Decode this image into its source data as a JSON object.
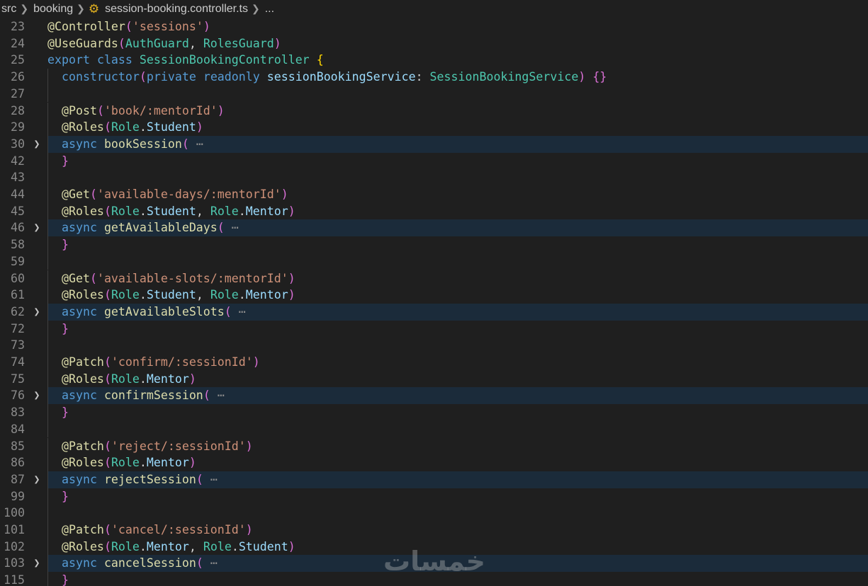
{
  "breadcrumb": {
    "items": [
      "src",
      "booking",
      "session-booking.controller.ts",
      "..."
    ],
    "file_icon": "gear-icon",
    "separator_icon": "chevron-right-icon"
  },
  "colors": {
    "background": "#1f1f1f",
    "highlight": "#1b2b3a",
    "decorator": "#dcdcaa",
    "string": "#ce9178",
    "type": "#4ec9b0",
    "keyword": "#569cd6",
    "variable": "#9cdcfe",
    "paren": "#da70d6",
    "brace": "#ffd700"
  },
  "editor": {
    "lines": [
      {
        "n": "23",
        "tokens": [
          [
            "dec",
            "@Controller"
          ],
          [
            "paren",
            "("
          ],
          [
            "str",
            "'sessions'"
          ],
          [
            "paren",
            ")"
          ]
        ]
      },
      {
        "n": "24",
        "tokens": [
          [
            "dec",
            "@UseGuards"
          ],
          [
            "paren",
            "("
          ],
          [
            "typ",
            "AuthGuard"
          ],
          [
            "pl",
            ", "
          ],
          [
            "typ",
            "RolesGuard"
          ],
          [
            "paren",
            ")"
          ]
        ]
      },
      {
        "n": "25",
        "tokens": [
          [
            "kw",
            "export"
          ],
          [
            "pl",
            " "
          ],
          [
            "kw",
            "class"
          ],
          [
            "pl",
            " "
          ],
          [
            "typ",
            "SessionBookingController"
          ],
          [
            "pl",
            " "
          ],
          [
            "br",
            "{"
          ]
        ]
      },
      {
        "n": "26",
        "tokens": [
          [
            "pl",
            "  "
          ],
          [
            "kw",
            "constructor"
          ],
          [
            "paren",
            "("
          ],
          [
            "kw",
            "private"
          ],
          [
            "pl",
            " "
          ],
          [
            "kw",
            "readonly"
          ],
          [
            "pl",
            " "
          ],
          [
            "vr",
            "sessionBookingService"
          ],
          [
            "pl",
            ": "
          ],
          [
            "typ",
            "SessionBookingService"
          ],
          [
            "paren",
            ")"
          ],
          [
            "pl",
            " "
          ],
          [
            "paren",
            "{}"
          ]
        ]
      },
      {
        "n": "27",
        "tokens": []
      },
      {
        "n": "28",
        "tokens": [
          [
            "pl",
            "  "
          ],
          [
            "dec",
            "@Post"
          ],
          [
            "paren",
            "("
          ],
          [
            "str",
            "'book/:mentorId'"
          ],
          [
            "paren",
            ")"
          ]
        ]
      },
      {
        "n": "29",
        "tokens": [
          [
            "pl",
            "  "
          ],
          [
            "dec",
            "@Roles"
          ],
          [
            "paren",
            "("
          ],
          [
            "typ",
            "Role"
          ],
          [
            "pl",
            "."
          ],
          [
            "vr",
            "Student"
          ],
          [
            "paren",
            ")"
          ]
        ]
      },
      {
        "n": "30",
        "fold": true,
        "tokens": [
          [
            "pl",
            "  "
          ],
          [
            "kw",
            "async"
          ],
          [
            "pl",
            " "
          ],
          [
            "fn",
            "bookSession"
          ],
          [
            "paren",
            "("
          ],
          [
            "pl",
            " "
          ],
          [
            "dots",
            "⋯"
          ]
        ]
      },
      {
        "n": "42",
        "tokens": [
          [
            "pl",
            "  "
          ],
          [
            "paren",
            "}"
          ]
        ]
      },
      {
        "n": "43",
        "tokens": []
      },
      {
        "n": "44",
        "tokens": [
          [
            "pl",
            "  "
          ],
          [
            "dec",
            "@Get"
          ],
          [
            "paren",
            "("
          ],
          [
            "str",
            "'available-days/:mentorId'"
          ],
          [
            "paren",
            ")"
          ]
        ]
      },
      {
        "n": "45",
        "tokens": [
          [
            "pl",
            "  "
          ],
          [
            "dec",
            "@Roles"
          ],
          [
            "paren",
            "("
          ],
          [
            "typ",
            "Role"
          ],
          [
            "pl",
            "."
          ],
          [
            "vr",
            "Student"
          ],
          [
            "pl",
            ", "
          ],
          [
            "typ",
            "Role"
          ],
          [
            "pl",
            "."
          ],
          [
            "vr",
            "Mentor"
          ],
          [
            "paren",
            ")"
          ]
        ]
      },
      {
        "n": "46",
        "fold": true,
        "tokens": [
          [
            "pl",
            "  "
          ],
          [
            "kw",
            "async"
          ],
          [
            "pl",
            " "
          ],
          [
            "fn",
            "getAvailableDays"
          ],
          [
            "paren",
            "("
          ],
          [
            "pl",
            " "
          ],
          [
            "dots",
            "⋯"
          ]
        ]
      },
      {
        "n": "58",
        "tokens": [
          [
            "pl",
            "  "
          ],
          [
            "paren",
            "}"
          ]
        ]
      },
      {
        "n": "59",
        "tokens": []
      },
      {
        "n": "60",
        "tokens": [
          [
            "pl",
            "  "
          ],
          [
            "dec",
            "@Get"
          ],
          [
            "paren",
            "("
          ],
          [
            "str",
            "'available-slots/:mentorId'"
          ],
          [
            "paren",
            ")"
          ]
        ]
      },
      {
        "n": "61",
        "tokens": [
          [
            "pl",
            "  "
          ],
          [
            "dec",
            "@Roles"
          ],
          [
            "paren",
            "("
          ],
          [
            "typ",
            "Role"
          ],
          [
            "pl",
            "."
          ],
          [
            "vr",
            "Student"
          ],
          [
            "pl",
            ", "
          ],
          [
            "typ",
            "Role"
          ],
          [
            "pl",
            "."
          ],
          [
            "vr",
            "Mentor"
          ],
          [
            "paren",
            ")"
          ]
        ]
      },
      {
        "n": "62",
        "fold": true,
        "tokens": [
          [
            "pl",
            "  "
          ],
          [
            "kw",
            "async"
          ],
          [
            "pl",
            " "
          ],
          [
            "fn",
            "getAvailableSlots"
          ],
          [
            "paren",
            "("
          ],
          [
            "pl",
            " "
          ],
          [
            "dots",
            "⋯"
          ]
        ]
      },
      {
        "n": "72",
        "tokens": [
          [
            "pl",
            "  "
          ],
          [
            "paren",
            "}"
          ]
        ]
      },
      {
        "n": "73",
        "tokens": []
      },
      {
        "n": "74",
        "tokens": [
          [
            "pl",
            "  "
          ],
          [
            "dec",
            "@Patch"
          ],
          [
            "paren",
            "("
          ],
          [
            "str",
            "'confirm/:sessionId'"
          ],
          [
            "paren",
            ")"
          ]
        ]
      },
      {
        "n": "75",
        "tokens": [
          [
            "pl",
            "  "
          ],
          [
            "dec",
            "@Roles"
          ],
          [
            "paren",
            "("
          ],
          [
            "typ",
            "Role"
          ],
          [
            "pl",
            "."
          ],
          [
            "vr",
            "Mentor"
          ],
          [
            "paren",
            ")"
          ]
        ]
      },
      {
        "n": "76",
        "fold": true,
        "tokens": [
          [
            "pl",
            "  "
          ],
          [
            "kw",
            "async"
          ],
          [
            "pl",
            " "
          ],
          [
            "fn",
            "confirmSession"
          ],
          [
            "paren",
            "("
          ],
          [
            "pl",
            " "
          ],
          [
            "dots",
            "⋯"
          ]
        ]
      },
      {
        "n": "83",
        "tokens": [
          [
            "pl",
            "  "
          ],
          [
            "paren",
            "}"
          ]
        ]
      },
      {
        "n": "84",
        "tokens": []
      },
      {
        "n": "85",
        "tokens": [
          [
            "pl",
            "  "
          ],
          [
            "dec",
            "@Patch"
          ],
          [
            "paren",
            "("
          ],
          [
            "str",
            "'reject/:sessionId'"
          ],
          [
            "paren",
            ")"
          ]
        ]
      },
      {
        "n": "86",
        "tokens": [
          [
            "pl",
            "  "
          ],
          [
            "dec",
            "@Roles"
          ],
          [
            "paren",
            "("
          ],
          [
            "typ",
            "Role"
          ],
          [
            "pl",
            "."
          ],
          [
            "vr",
            "Mentor"
          ],
          [
            "paren",
            ")"
          ]
        ]
      },
      {
        "n": "87",
        "fold": true,
        "tokens": [
          [
            "pl",
            "  "
          ],
          [
            "kw",
            "async"
          ],
          [
            "pl",
            " "
          ],
          [
            "fn",
            "rejectSession"
          ],
          [
            "paren",
            "("
          ],
          [
            "pl",
            " "
          ],
          [
            "dots",
            "⋯"
          ]
        ]
      },
      {
        "n": "99",
        "tokens": [
          [
            "pl",
            "  "
          ],
          [
            "paren",
            "}"
          ]
        ]
      },
      {
        "n": "100",
        "tokens": []
      },
      {
        "n": "101",
        "tokens": [
          [
            "pl",
            "  "
          ],
          [
            "dec",
            "@Patch"
          ],
          [
            "paren",
            "("
          ],
          [
            "str",
            "'cancel/:sessionId'"
          ],
          [
            "paren",
            ")"
          ]
        ]
      },
      {
        "n": "102",
        "tokens": [
          [
            "pl",
            "  "
          ],
          [
            "dec",
            "@Roles"
          ],
          [
            "paren",
            "("
          ],
          [
            "typ",
            "Role"
          ],
          [
            "pl",
            "."
          ],
          [
            "vr",
            "Mentor"
          ],
          [
            "pl",
            ", "
          ],
          [
            "typ",
            "Role"
          ],
          [
            "pl",
            "."
          ],
          [
            "vr",
            "Student"
          ],
          [
            "paren",
            ")"
          ]
        ]
      },
      {
        "n": "103",
        "fold": true,
        "tokens": [
          [
            "pl",
            "  "
          ],
          [
            "kw",
            "async"
          ],
          [
            "pl",
            " "
          ],
          [
            "fn",
            "cancelSession"
          ],
          [
            "paren",
            "("
          ],
          [
            "pl",
            " "
          ],
          [
            "dots",
            "⋯"
          ]
        ]
      },
      {
        "n": "115",
        "tokens": [
          [
            "pl",
            "  "
          ],
          [
            "paren",
            "}"
          ]
        ]
      }
    ]
  },
  "watermark": {
    "text": "خمسات"
  }
}
